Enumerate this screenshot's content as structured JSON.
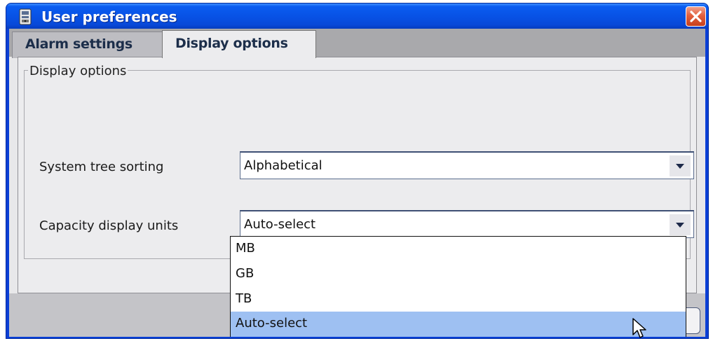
{
  "window": {
    "title": "User preferences",
    "title_icon": "preferences-app-icon",
    "close_icon": "close-x-icon"
  },
  "tabs": [
    {
      "label": "Alarm settings",
      "active": false
    },
    {
      "label": "Display options",
      "active": true
    }
  ],
  "group": {
    "legend": "Display options"
  },
  "fields": {
    "sorting": {
      "label": "System tree sorting",
      "value": "Alphabetical"
    },
    "capacity": {
      "label": "Capacity display units",
      "value": "Auto-select"
    }
  },
  "dropdown": {
    "options": [
      "MB",
      "GB",
      "TB",
      "Auto-select"
    ],
    "selected": "Auto-select"
  },
  "colors": {
    "title_bar": "#0851e4",
    "selection": "#9ec0f2",
    "close_button": "#e3603e"
  }
}
